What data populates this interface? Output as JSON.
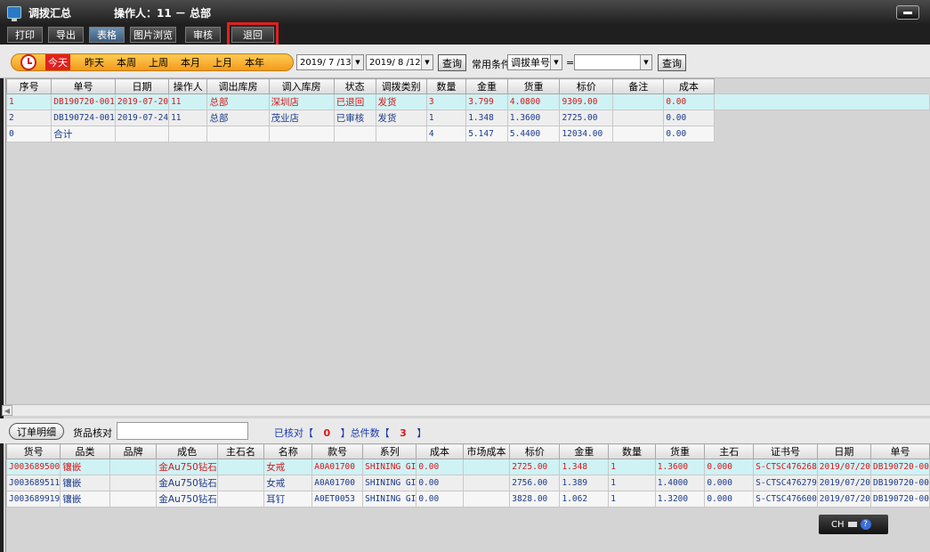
{
  "window": {
    "title": "调拨汇总",
    "operator": "操作人：11 － 总部"
  },
  "toolbar": {
    "print": "打印",
    "export": "导出",
    "table": "表格",
    "image_browse": "图片浏览",
    "review": "审核",
    "return": "退回"
  },
  "filter": {
    "periods": [
      "今天",
      "昨天",
      "本周",
      "上周",
      "本月",
      "上月",
      "本年"
    ],
    "date_from": "2019/ 7 /13",
    "date_to": "2019/ 8 /12",
    "query1": "查询",
    "common_label": "常用条件",
    "condition_field": "调拔单号",
    "operator": "=",
    "condition_value": "",
    "query2": "查询"
  },
  "main_table": {
    "headers": [
      "序号",
      "单号",
      "日期",
      "操作人",
      "调出库房",
      "调入库房",
      "状态",
      "调拨类别",
      "数量",
      "金重",
      "货重",
      "标价",
      "备注",
      "成本"
    ],
    "rows": [
      [
        "1",
        "DB190720-001",
        "2019-07-20",
        "11",
        "总部",
        "深圳店",
        "已退回",
        "发货",
        "3",
        "3.799",
        "4.0800",
        "9309.00",
        "",
        "0.00"
      ],
      [
        "2",
        "DB190724-001",
        "2019-07-24",
        "11",
        "总部",
        "茂业店",
        "已审核",
        "发货",
        "1",
        "1.348",
        "1.3600",
        "2725.00",
        "",
        "0.00"
      ],
      [
        "0",
        "合计",
        "",
        "",
        "",
        "",
        "",
        "",
        "4",
        "5.147",
        "5.4400",
        "12034.00",
        "",
        "0.00"
      ]
    ]
  },
  "bottom": {
    "order_detail": "订单明细",
    "goods_check": "货品核对",
    "checked_label": "已核对【",
    "checked_count": "0",
    "total_label": "】总件数【",
    "total_count": "3",
    "close_bracket": "】"
  },
  "detail_table": {
    "headers": [
      "货号",
      "品类",
      "品牌",
      "成色",
      "主石名",
      "名称",
      "款号",
      "系列",
      "成本",
      "市场成本",
      "标价",
      "金重",
      "数量",
      "货重",
      "主石",
      "证书号",
      "日期",
      "单号"
    ],
    "rows": [
      [
        "J003689500",
        "镶嵌",
        "",
        "金Au750钻石",
        "",
        "女戒",
        "A0A01700",
        "SHINING GI",
        "0.00",
        "",
        "2725.00",
        "1.348",
        "1",
        "1.3600",
        "0.000",
        "S-CTSC476268",
        "2019/07/20",
        "DB190720-00"
      ],
      [
        "J003689511",
        "镶嵌",
        "",
        "金Au750钻石",
        "",
        "女戒",
        "A0A01700",
        "SHINING GI",
        "0.00",
        "",
        "2756.00",
        "1.389",
        "1",
        "1.4000",
        "0.000",
        "S-CTSC476279",
        "2019/07/20",
        "DB190720-00"
      ],
      [
        "J003689919",
        "镶嵌",
        "",
        "金Au750钻石",
        "",
        "耳钉",
        "A0ET0053",
        "SHINING GI",
        "0.00",
        "",
        "3828.00",
        "1.062",
        "1",
        "1.3200",
        "0.000",
        "S-CTSC476600",
        "2019/07/20",
        "DB190720-00"
      ]
    ]
  },
  "ime": {
    "lang": "CH"
  },
  "colors": {
    "highlight_outline": "#e02020",
    "selected_row": "#cff2f5",
    "red_text": "#d81818",
    "blue_text": "#1a3a8a"
  }
}
